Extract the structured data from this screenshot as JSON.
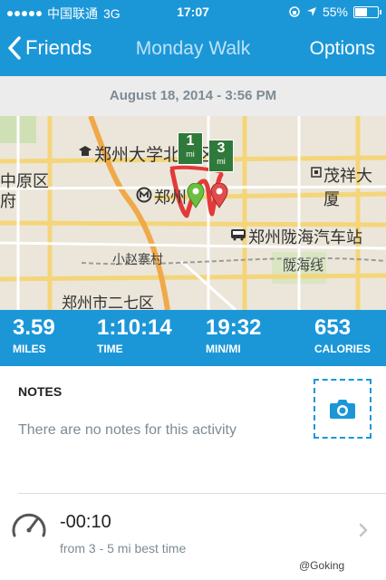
{
  "status_bar": {
    "carrier": "中国联通",
    "network": "3G",
    "time": "17:07",
    "battery": "55%",
    "battery_level": 0.55
  },
  "nav": {
    "back_label": "Friends",
    "title": "Monday Walk",
    "options_label": "Options"
  },
  "activity_datetime": "August 18, 2014 - 3:56 PM",
  "map": {
    "labels": {
      "university": "郑州大学北校区",
      "zhongyuan": "中原区",
      "fu": "府",
      "zhengzhou_station": "郑州",
      "maoxiang": "茂祥大厦",
      "bus_station": "郑州陇海汽车站",
      "village": "小赵寨村",
      "longhai": "陇海线",
      "district": "郑州市二七区"
    },
    "markers": {
      "m1": "1",
      "m3": "3",
      "unit": "mi"
    }
  },
  "stats": [
    {
      "value": "3.59",
      "label": "MILES"
    },
    {
      "value": "1:10:14",
      "label": "TIME"
    },
    {
      "value": "19:32",
      "label": "MIN/MI"
    },
    {
      "value": "653",
      "label": "CALORIES"
    }
  ],
  "notes": {
    "title": "NOTES",
    "empty_text": "There are no notes for this activity"
  },
  "best": {
    "time": "-00:10",
    "subtitle": "from 3 - 5 mi best time"
  },
  "watermark": "@Goking",
  "colors": {
    "brand_blue": "#1b97d8",
    "gray_text": "#7d8b95"
  }
}
